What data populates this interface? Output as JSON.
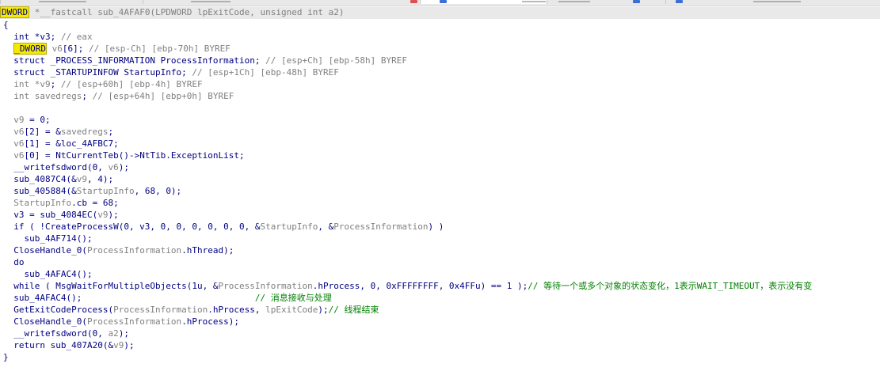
{
  "tabs": [
    {
      "name": "tab-1",
      "color": "#e8e8e8"
    },
    {
      "name": "tab-2",
      "color": "#e8e8e8",
      "icon": "close-icon",
      "icon_color": "#e05050"
    },
    {
      "name": "tab-3",
      "color": "#e8e8e8",
      "icon": "doc-icon",
      "icon_color": "#3b6fd6"
    },
    {
      "name": "tab-4",
      "color": "#e8e8e8",
      "icon": "doc-icon",
      "icon_color": "#3b6fd6"
    },
    {
      "name": "tab-5",
      "color": "#e8e8e8"
    }
  ],
  "decl": {
    "type_hl": "DWORD",
    "text": " *__fastcall sub_4AFAF0(LPDWORD lpExitCode, unsigned int a2)"
  },
  "code": {
    "lines": [
      "{",
      "  int *v3; // eax",
      "  _DWORD v6[6]; // [esp-Ch] [ebp-70h] BYREF",
      "  struct _PROCESS_INFORMATION ProcessInformation; // [esp+Ch] [ebp-58h] BYREF",
      "  struct _STARTUPINFOW StartupInfo; // [esp+1Ch] [ebp-48h] BYREF",
      "  int *v9; // [esp+60h] [ebp-4h] BYREF",
      "  int savedregs; // [esp+64h] [ebp+0h] BYREF",
      "",
      "  v9 = 0;",
      "  v6[2] = &savedregs;",
      "  v6[1] = &loc_4AFBC7;",
      "  v6[0] = NtCurrentTeb()->NtTib.ExceptionList;",
      "  __writefsdword(0, v6);",
      "  sub_4087C4(&v9, 4);",
      "  sub_405884(&StartupInfo, 68, 0);",
      "  StartupInfo.cb = 68;",
      "  v3 = sub_4084EC(v9);",
      "  if ( !CreateProcessW(0, v3, 0, 0, 0, 0, 0, 0, &StartupInfo, &ProcessInformation) )",
      "    sub_4AF714();",
      "  CloseHandle_0(ProcessInformation.hThread);",
      "  do",
      "    sub_4AFAC4();",
      "  while ( MsgWaitForMultipleObjects(1u, &ProcessInformation.hProcess, 0, 0xFFFFFFFF, 0x4FFu) == 1 );// 等待一个或多个对象的状态变化，1表示WAIT_TIMEOUT，表示没有变",
      "  sub_4AFAC4();                                 // 消息接收与处理",
      "  GetExitCodeProcess(ProcessInformation.hProcess, lpExitCode);// 线程结束",
      "  CloseHandle_0(ProcessInformation.hProcess);",
      "  __writefsdword(0, a2);",
      "  return sub_407A20(&v9);",
      "}"
    ]
  }
}
